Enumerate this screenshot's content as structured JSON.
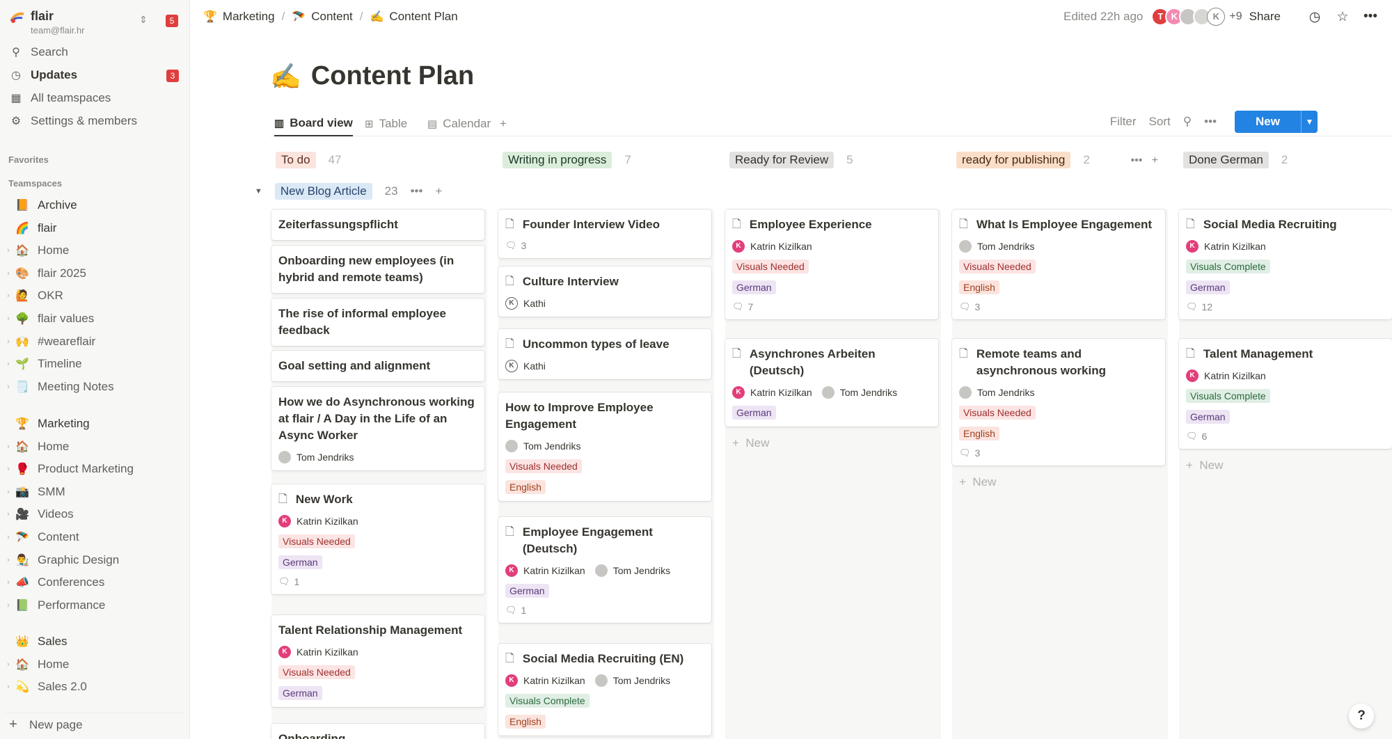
{
  "workspace": {
    "name": "flair",
    "email": "team@flair.hr",
    "badge": "5"
  },
  "nav": [
    {
      "icon": "search-icon",
      "glyph": "⚲",
      "label": "Search"
    },
    {
      "icon": "clock-icon",
      "glyph": "◷",
      "label": "Updates",
      "badge": "3"
    },
    {
      "icon": "teamspaces-icon",
      "glyph": "▦",
      "label": "All teamspaces"
    },
    {
      "icon": "gear-icon",
      "glyph": "⚙",
      "label": "Settings & members"
    }
  ],
  "sections": {
    "favorites": "Favorites",
    "teamspaces": "Teamspaces"
  },
  "teamspace_items": [
    {
      "emoji": "📙",
      "label": "Archive",
      "top": true
    },
    {
      "emoji": "🌈",
      "label": "flair",
      "top": true
    },
    {
      "emoji": "🏠",
      "label": "Home"
    },
    {
      "emoji": "🎨",
      "label": "flair 2025"
    },
    {
      "emoji": "🙋",
      "label": "OKR"
    },
    {
      "emoji": "🌳",
      "label": "flair values"
    },
    {
      "emoji": "🙌",
      "label": "#weareflair"
    },
    {
      "emoji": "🌱",
      "label": "Timeline"
    },
    {
      "emoji": "🗒️",
      "label": "Meeting Notes"
    }
  ],
  "marketing_items": [
    {
      "emoji": "🏆",
      "label": "Marketing",
      "top": true
    },
    {
      "emoji": "🏠",
      "label": "Home"
    },
    {
      "emoji": "🥊",
      "label": "Product Marketing"
    },
    {
      "emoji": "📸",
      "label": "SMM"
    },
    {
      "emoji": "🎥",
      "label": "Videos"
    },
    {
      "emoji": "🪂",
      "label": "Content"
    },
    {
      "emoji": "👨‍🎨",
      "label": "Graphic Design"
    },
    {
      "emoji": "📣",
      "label": "Conferences"
    },
    {
      "emoji": "📗",
      "label": "Performance"
    }
  ],
  "sales_items": [
    {
      "emoji": "👑",
      "label": "Sales",
      "top": true
    },
    {
      "emoji": "🏠",
      "label": "Home"
    },
    {
      "emoji": "💫",
      "label": "Sales 2.0"
    }
  ],
  "new_page": "New page",
  "breadcrumbs": [
    {
      "emoji": "🏆",
      "label": "Marketing"
    },
    {
      "emoji": "🪂",
      "label": "Content"
    },
    {
      "emoji": "✍️",
      "label": "Content Plan"
    }
  ],
  "topbar": {
    "edited": "Edited 22h ago",
    "avatars": [
      {
        "letter": "T",
        "color": "#e03e3e"
      },
      {
        "letter": "K",
        "color": "#f28bb2"
      },
      {
        "letter": "",
        "color": "#c7c6c3"
      },
      {
        "letter": "",
        "color": "#d7d6d3"
      },
      {
        "letter": "K",
        "color": "#ffffff"
      }
    ],
    "more": "+9",
    "share": "Share"
  },
  "page": {
    "emoji": "✍️",
    "title": "Content Plan"
  },
  "views": [
    {
      "icon": "board-icon",
      "glyph": "▥",
      "label": "Board view"
    },
    {
      "icon": "table-icon",
      "glyph": "⊞",
      "label": "Table"
    },
    {
      "icon": "calendar-icon",
      "glyph": "▤",
      "label": "Calendar"
    }
  ],
  "toolbar": {
    "filter": "Filter",
    "sort": "Sort",
    "new": "New"
  },
  "group": {
    "label": "New Blog Article",
    "count": "23"
  },
  "columns": [
    {
      "name": "To do",
      "count": "47",
      "color": "t-orange",
      "cards": [
        {
          "title": "Zeiterfassungspflicht"
        },
        {
          "title": "Onboarding new employees (in hybrid and remote teams)"
        },
        {
          "title": "The rise of informal employee feedback"
        },
        {
          "title": "Goal setting and alignment"
        },
        {
          "title": "How we do Asynchronous working at flair  / A Day in the Life of an Async Worker",
          "people": [
            {
              "name": "Tom Jendriks",
              "type": "t",
              "letter": ""
            }
          ]
        },
        {
          "title": "New Work",
          "doc": true,
          "people": [
            {
              "name": "Katrin Kizilkan",
              "type": "k",
              "letter": "K"
            }
          ],
          "tags": [
            {
              "label": "Visuals Needed",
              "cls": "t-red"
            },
            {
              "label": "German",
              "cls": "t-purple"
            }
          ],
          "comments": "1"
        },
        {
          "title": "Talent Relationship Management",
          "people": [
            {
              "name": "Katrin Kizilkan",
              "type": "k",
              "letter": "K"
            }
          ],
          "tags": [
            {
              "label": "Visuals Needed",
              "cls": "t-red"
            },
            {
              "label": "German",
              "cls": "t-purple"
            }
          ]
        },
        {
          "title": "Onboarding"
        }
      ]
    },
    {
      "name": "Writing in progress",
      "count": "7",
      "color": "t-green",
      "cards": [
        {
          "title": "Founder Interview Video",
          "doc": true,
          "comments": "3"
        },
        {
          "title": "Culture Interview",
          "doc": true,
          "people": [
            {
              "name": "Kathi",
              "type": "o",
              "letter": "K"
            }
          ]
        },
        {
          "title": "Uncommon types of leave",
          "doc": true,
          "people": [
            {
              "name": "Kathi",
              "type": "o",
              "letter": "K"
            }
          ]
        },
        {
          "title": "How to Improve Employee Engagement",
          "people": [
            {
              "name": "Tom Jendriks",
              "type": "t",
              "letter": ""
            }
          ],
          "tags": [
            {
              "label": "Visuals Needed",
              "cls": "t-red"
            },
            {
              "label": "English",
              "cls": "t-orange"
            }
          ]
        },
        {
          "title": "Employee Engagement (Deutsch)",
          "doc": true,
          "people": [
            {
              "name": "Katrin Kizilkan",
              "type": "k",
              "letter": "K"
            },
            {
              "name": "Tom Jendriks",
              "type": "t",
              "letter": ""
            }
          ],
          "tags": [
            {
              "label": "German",
              "cls": "t-purple"
            }
          ],
          "comments": "1"
        },
        {
          "title": "Social Media Recruiting (EN)",
          "doc": true,
          "people": [
            {
              "name": "Katrin Kizilkan",
              "type": "k",
              "letter": "K"
            },
            {
              "name": "Tom Jendriks",
              "type": "t",
              "letter": ""
            }
          ],
          "tags": [
            {
              "label": "Visuals Complete",
              "cls": "t-green"
            },
            {
              "label": "English",
              "cls": "t-orange"
            }
          ]
        }
      ]
    },
    {
      "name": "Ready for Review",
      "count": "5",
      "color": "gray",
      "cards": [
        {
          "title": "Employee Experience",
          "doc": true,
          "people": [
            {
              "name": "Katrin Kizilkan",
              "type": "k",
              "letter": "K"
            }
          ],
          "tags": [
            {
              "label": "Visuals Needed",
              "cls": "t-red"
            },
            {
              "label": "German",
              "cls": "t-purple"
            }
          ],
          "comments": "7"
        },
        {
          "title": "Asynchrones Arbeiten (Deutsch)",
          "doc": true,
          "people": [
            {
              "name": "Katrin Kizilkan",
              "type": "k",
              "letter": "K"
            },
            {
              "name": "Tom Jendriks",
              "type": "t",
              "letter": ""
            }
          ],
          "tags": [
            {
              "label": "German",
              "cls": "t-purple"
            }
          ]
        }
      ],
      "add": "New"
    },
    {
      "name": "ready for publishing",
      "count": "2",
      "color": "t-orange-strong",
      "cards": [
        {
          "title": "What Is Employee Engagement",
          "doc": true,
          "people": [
            {
              "name": "Tom Jendriks",
              "type": "t",
              "letter": ""
            }
          ],
          "tags": [
            {
              "label": "Visuals Needed",
              "cls": "t-red"
            },
            {
              "label": "English",
              "cls": "t-orange"
            }
          ],
          "comments": "3"
        },
        {
          "title": "Remote teams and asynchronous working",
          "doc": true,
          "people": [
            {
              "name": "Tom Jendriks",
              "type": "t",
              "letter": ""
            }
          ],
          "tags": [
            {
              "label": "Visuals Needed",
              "cls": "t-red"
            },
            {
              "label": "English",
              "cls": "t-orange"
            }
          ],
          "comments": "3"
        }
      ],
      "add": "New"
    },
    {
      "name": "Done German",
      "count": "2",
      "color": "gray",
      "cards": [
        {
          "title": "Social Media Recruiting",
          "doc": true,
          "people": [
            {
              "name": "Katrin Kizilkan",
              "type": "k",
              "letter": "K"
            }
          ],
          "tags": [
            {
              "label": "Visuals Complete",
              "cls": "t-green"
            },
            {
              "label": "German",
              "cls": "t-purple"
            }
          ],
          "comments": "12"
        },
        {
          "title": "Talent Management",
          "doc": true,
          "people": [
            {
              "name": "Katrin Kizilkan",
              "type": "k",
              "letter": "K"
            }
          ],
          "tags": [
            {
              "label": "Visuals Complete",
              "cls": "t-green"
            },
            {
              "label": "German",
              "cls": "t-purple"
            }
          ],
          "comments": "6"
        }
      ],
      "add": "New"
    }
  ],
  "help": "?"
}
